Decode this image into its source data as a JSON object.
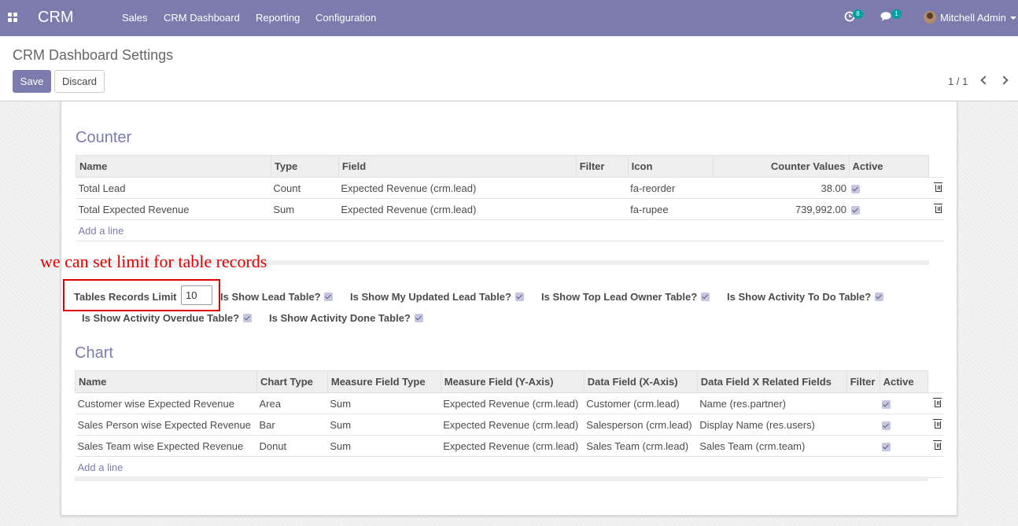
{
  "navbar": {
    "apps_icon": "grid-icon",
    "brand": "CRM",
    "menus": [
      "Sales",
      "CRM Dashboard",
      "Reporting",
      "Configuration"
    ],
    "activity_count": "8",
    "messages_count": "1",
    "user_name": "Mitchell Admin"
  },
  "control_panel": {
    "title": "CRM Dashboard Settings",
    "save_label": "Save",
    "discard_label": "Discard",
    "pager": "1 / 1"
  },
  "counter": {
    "title": "Counter",
    "headers": [
      "Name",
      "Type",
      "Field",
      "Filter",
      "Icon",
      "Counter Values",
      "Active"
    ],
    "rows": [
      {
        "name": "Total Lead",
        "type": "Count",
        "field": "Expected Revenue (crm.lead)",
        "filter": "",
        "icon": "fa-reorder",
        "value": "38.00",
        "active": true
      },
      {
        "name": "Total Expected Revenue",
        "type": "Sum",
        "field": "Expected Revenue (crm.lead)",
        "filter": "",
        "icon": "fa-rupee",
        "value": "739,992.00",
        "active": true
      }
    ],
    "add_line": "Add a line"
  },
  "annotation": "we can set limit for table records",
  "settings": {
    "limit_label": "Tables Records Limit",
    "limit_value": "10",
    "show_lead": "Is Show Lead Table?",
    "show_updated": "Is Show My Updated Lead Table?",
    "show_top_owner": "Is Show Top Lead Owner Table?",
    "show_todo": "Is Show Activity To Do Table?",
    "show_overdue": "Is Show Activity Overdue Table?",
    "show_done": "Is Show Activity Done Table?"
  },
  "chart": {
    "title": "Chart",
    "headers": [
      "Name",
      "Chart Type",
      "Measure Field Type",
      "Measure Field (Y-Axis)",
      "Data Field (X-Axis)",
      "Data Field X Related Fields",
      "Filter",
      "Active"
    ],
    "rows": [
      {
        "name": "Customer wise Expected Revenue",
        "chart_type": "Area",
        "measure_type": "Sum",
        "measure_field": "Expected Revenue (crm.lead)",
        "data_field": "Customer (crm.lead)",
        "related": "Name (res.partner)",
        "filter": "",
        "active": true
      },
      {
        "name": "Sales Person wise Expected Revenue",
        "chart_type": "Bar",
        "measure_type": "Sum",
        "measure_field": "Expected Revenue (crm.lead)",
        "data_field": "Salesperson (crm.lead)",
        "related": "Display Name (res.users)",
        "filter": "",
        "active": true
      },
      {
        "name": "Sales Team wise Expected Revenue",
        "chart_type": "Donut",
        "measure_type": "Sum",
        "measure_field": "Expected Revenue (crm.lead)",
        "data_field": "Sales Team (crm.lead)",
        "related": "Sales Team (crm.team)",
        "filter": "",
        "active": true
      }
    ],
    "add_line": "Add a line"
  }
}
